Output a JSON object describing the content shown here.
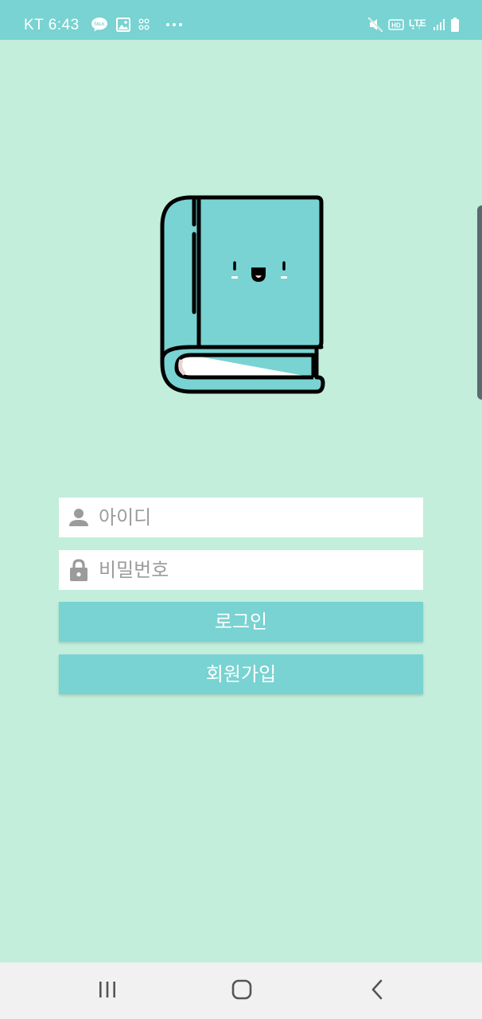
{
  "status_bar": {
    "carrier_time": "KT 6:43",
    "talk_badge": "TALK",
    "icons_left": [
      "kakaotalk-icon",
      "gallery-icon",
      "grid-app-icon",
      "more-notifications-icon"
    ],
    "icons_right": [
      "mute-icon",
      "hd-voice-icon",
      "lte-icon",
      "signal-icon",
      "battery-icon"
    ],
    "hd_label": "HD",
    "lte_label": "LTE",
    "lte_arrows": "↓↑",
    "background_color": "#78d3d2"
  },
  "login": {
    "id_placeholder": "아이디",
    "password_placeholder": "비밀번호",
    "login_button": "로그인",
    "signup_button": "회원가입"
  },
  "logo": {
    "icon": "smiling-book-icon",
    "color": "#78d3d2"
  },
  "nav_bar": {
    "recents_icon": "recents-icon",
    "home_icon": "home-icon",
    "back_icon": "back-icon"
  },
  "colors": {
    "background": "#c2eedb",
    "accent": "#78d3d2",
    "field_background": "#ffffff",
    "placeholder": "#9b9b9b",
    "icon_gray": "#9b9b9b",
    "nav_background": "#f1f1f1"
  }
}
